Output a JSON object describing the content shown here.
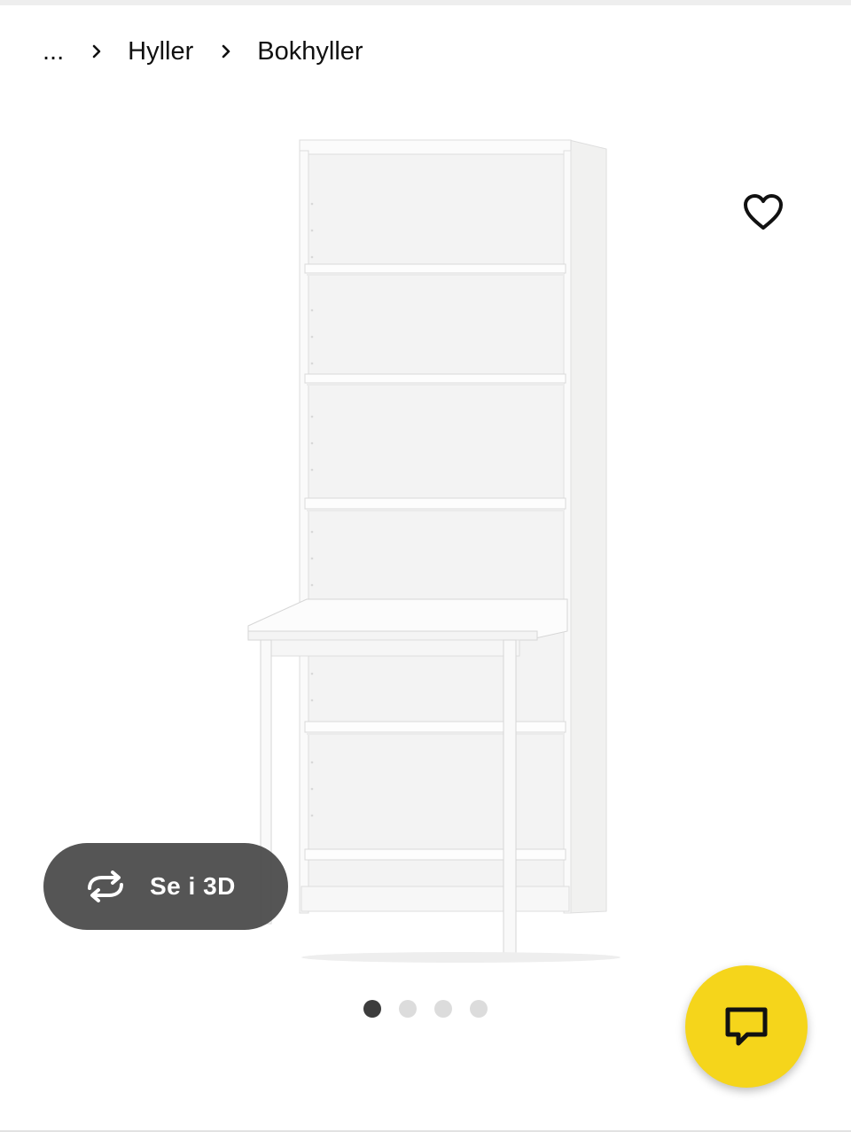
{
  "breadcrumb": {
    "items": [
      {
        "label": "..."
      },
      {
        "label": "Hyller"
      },
      {
        "label": "Bokhyller"
      }
    ]
  },
  "gallery": {
    "view3d_label": "Se i 3D",
    "dots_count": 4,
    "active_index": 0
  },
  "icons": {
    "favorite": "heart-outline-icon",
    "view3d": "rotate-3d-icon",
    "chat": "chat-bubble-icon",
    "separator": "chevron-right-icon"
  },
  "colors": {
    "chat_button": "#f5d51b",
    "view3d_button": "#484848",
    "dot_active": "#3c3c3c",
    "dot_inactive": "#dcdcdc"
  }
}
